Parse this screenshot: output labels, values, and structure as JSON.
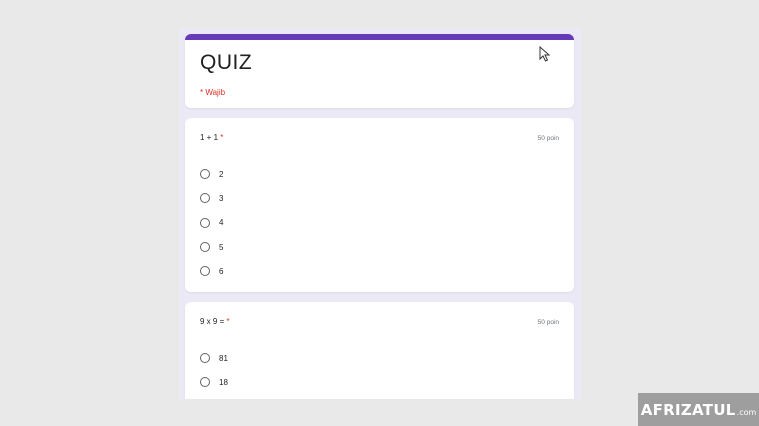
{
  "form": {
    "title": "QUIZ",
    "required_note": "* Wajib",
    "accent_color": "#673ab7"
  },
  "questions": [
    {
      "text": "1 + 1",
      "required_mark": "*",
      "points": "50 poin",
      "options": [
        "2",
        "3",
        "4",
        "5",
        "6"
      ]
    },
    {
      "text": "9 x 9 =",
      "required_mark": "*",
      "points": "50 poin",
      "options": [
        "81",
        "18"
      ]
    }
  ],
  "watermark": {
    "main": "AFRIZATUL",
    "suffix": ".com"
  },
  "icons": {
    "cursor": "mouse-pointer-icon"
  }
}
